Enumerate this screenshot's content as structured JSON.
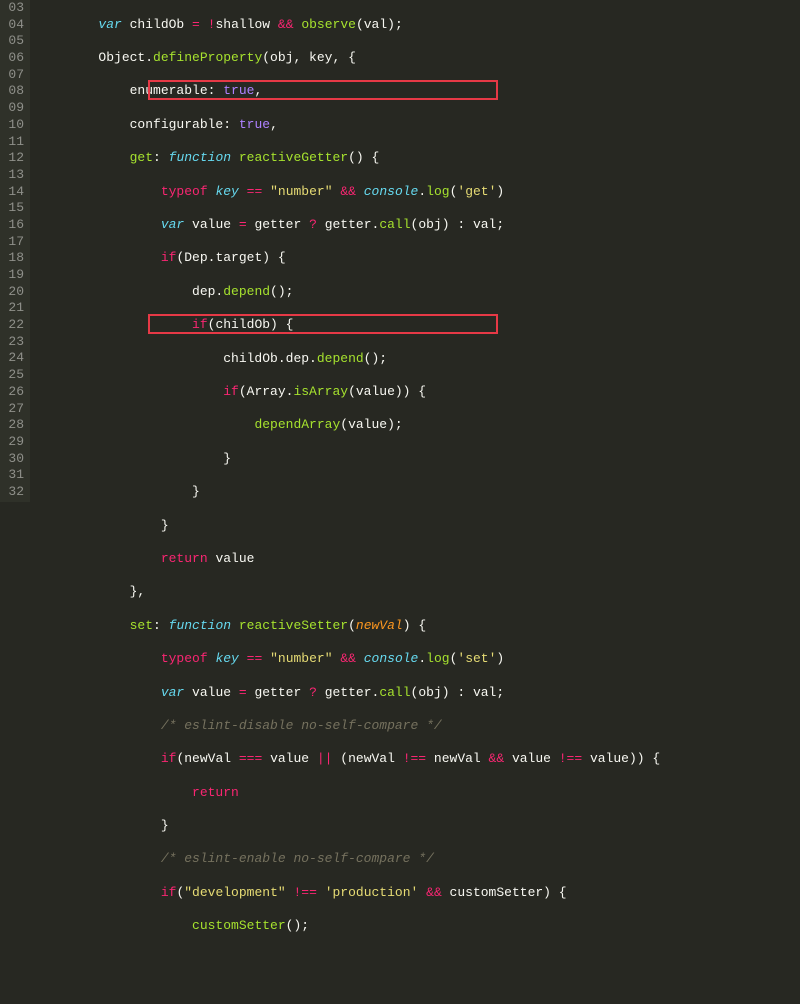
{
  "gutter": {
    "start": 3,
    "end": 32
  },
  "lines": {
    "ln3": "        var childOb = !shallow && observe(val);",
    "ln4": "        Object.defineProperty(obj, key, {",
    "ln5": "            enumerable: true,",
    "ln6": "            configurable: true,",
    "ln7": "            get: function reactiveGetter() {",
    "ln8": "                typeof key == \"number\" && console.log('get')",
    "ln9": "                var value = getter ? getter.call(obj) : val;",
    "ln10": "                if(Dep.target) {",
    "ln11": "                    dep.depend();",
    "ln12": "                    if(childOb) {",
    "ln13": "                        childOb.dep.depend();",
    "ln14": "                        if(Array.isArray(value)) {",
    "ln15": "                            dependArray(value);",
    "ln16": "                        }",
    "ln17": "                    }",
    "ln18": "                }",
    "ln19": "                return value",
    "ln20": "            },",
    "ln21": "            set: function reactiveSetter(newVal) {",
    "ln22": "                typeof key == \"number\" && console.log('set')",
    "ln23": "                var value = getter ? getter.call(obj) : val;",
    "ln24": "                /* eslint-disable no-self-compare */",
    "ln25": "                if(newVal === value || (newVal !== newVal && value !== value)) {",
    "ln26": "                    return",
    "ln27": "                }",
    "ln28": "                /* eslint-enable no-self-compare */",
    "ln29": "                if(\"development\" !== 'production' && customSetter) {",
    "ln30": "                    customSetter();"
  },
  "highlights": {
    "box1": {
      "line": 8,
      "text": "typeof key == \"number\" && console.log('get')"
    },
    "box2": {
      "line": 22,
      "text": "typeof key == \"number\" && console.log('set')"
    }
  },
  "chart_data": null
}
